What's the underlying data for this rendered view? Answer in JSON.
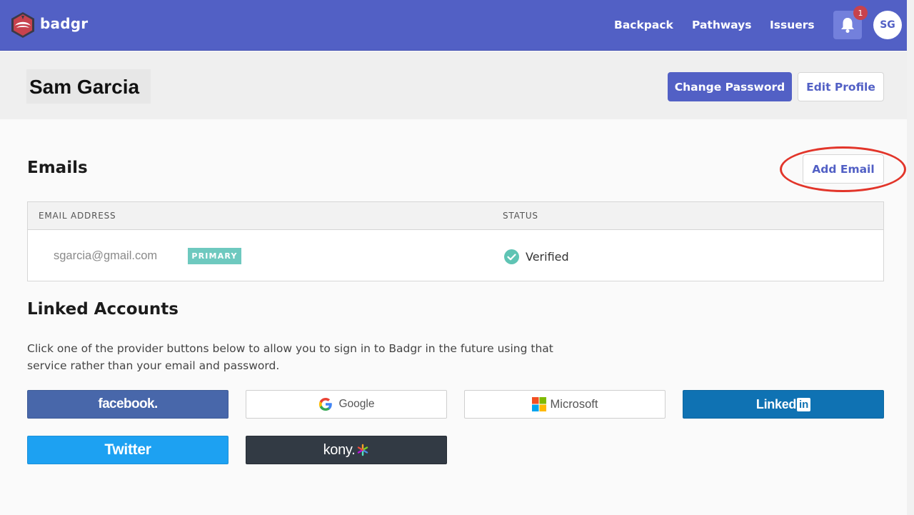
{
  "app": {
    "brand": "badgr"
  },
  "nav": {
    "items": [
      {
        "label": "Backpack"
      },
      {
        "label": "Pathways"
      },
      {
        "label": "Issuers"
      }
    ],
    "notification_count": "1",
    "avatar_initials": "SG"
  },
  "profile": {
    "name": "Sam Garcia",
    "change_password_label": "Change Password",
    "edit_profile_label": "Edit Profile"
  },
  "emails": {
    "title": "Emails",
    "add_email_label": "Add Email",
    "columns": [
      "EMAIL ADDRESS",
      "STATUS"
    ],
    "rows": [
      {
        "email": "sgarcia@gmail.com",
        "badge": "PRIMARY",
        "status": "Verified"
      }
    ]
  },
  "linked_accounts": {
    "title": "Linked Accounts",
    "description": "Click one of the provider buttons below to allow you to sign in to Badgr in the future using that service rather than your email and password.",
    "providers": [
      {
        "name": "facebook",
        "label": "facebook."
      },
      {
        "name": "google",
        "label": "Google"
      },
      {
        "name": "microsoft",
        "label": "Microsoft"
      },
      {
        "name": "linkedin",
        "label": "Linked",
        "badge": "in"
      },
      {
        "name": "twitter",
        "label": "Twitter"
      },
      {
        "name": "kony",
        "label": "kony."
      }
    ]
  },
  "colors": {
    "brand": "#5260c5",
    "accent_highlight": "#e2352a",
    "primary_badge": "#6ec9bf",
    "verified": "#5fc4b4"
  }
}
